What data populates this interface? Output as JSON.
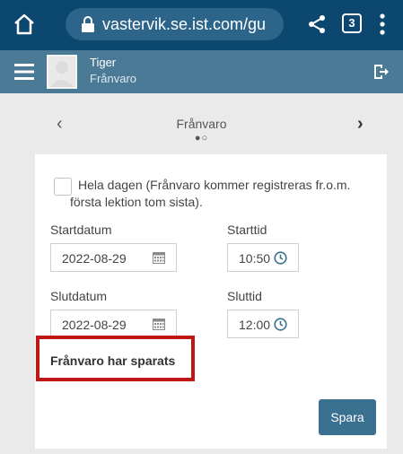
{
  "browser": {
    "url": "vastervik.se.ist.com/gu",
    "tab_count": "3",
    "icons": {
      "home": "home-icon",
      "lock": "lock-icon",
      "share": "share-icon",
      "menu": "more-vert-icon"
    }
  },
  "header": {
    "user_name": "Tiger",
    "section": "Frånvaro",
    "colors": {
      "bar": "#4a7a96",
      "browser": "#0c4770"
    }
  },
  "carousel": {
    "title": "Frånvaro",
    "prev_glyph": "‹",
    "next_glyph": "›",
    "dots": "●○"
  },
  "form": {
    "allday_line1": "Hela dagen (Frånvaro kommer registreras fr.o.m.",
    "allday_line2": "första lektion tom sista).",
    "allday_checked": false,
    "start_date_label": "Startdatum",
    "start_date_value": "2022-08-29",
    "start_time_label": "Starttid",
    "start_time_value": "10:50",
    "end_date_label": "Slutdatum",
    "end_date_value": "2022-08-29",
    "end_time_label": "Sluttid",
    "end_time_value": "12:00",
    "saved_message": "Frånvaro har sparats",
    "save_button": "Spara"
  },
  "highlight_color": "#c01616"
}
